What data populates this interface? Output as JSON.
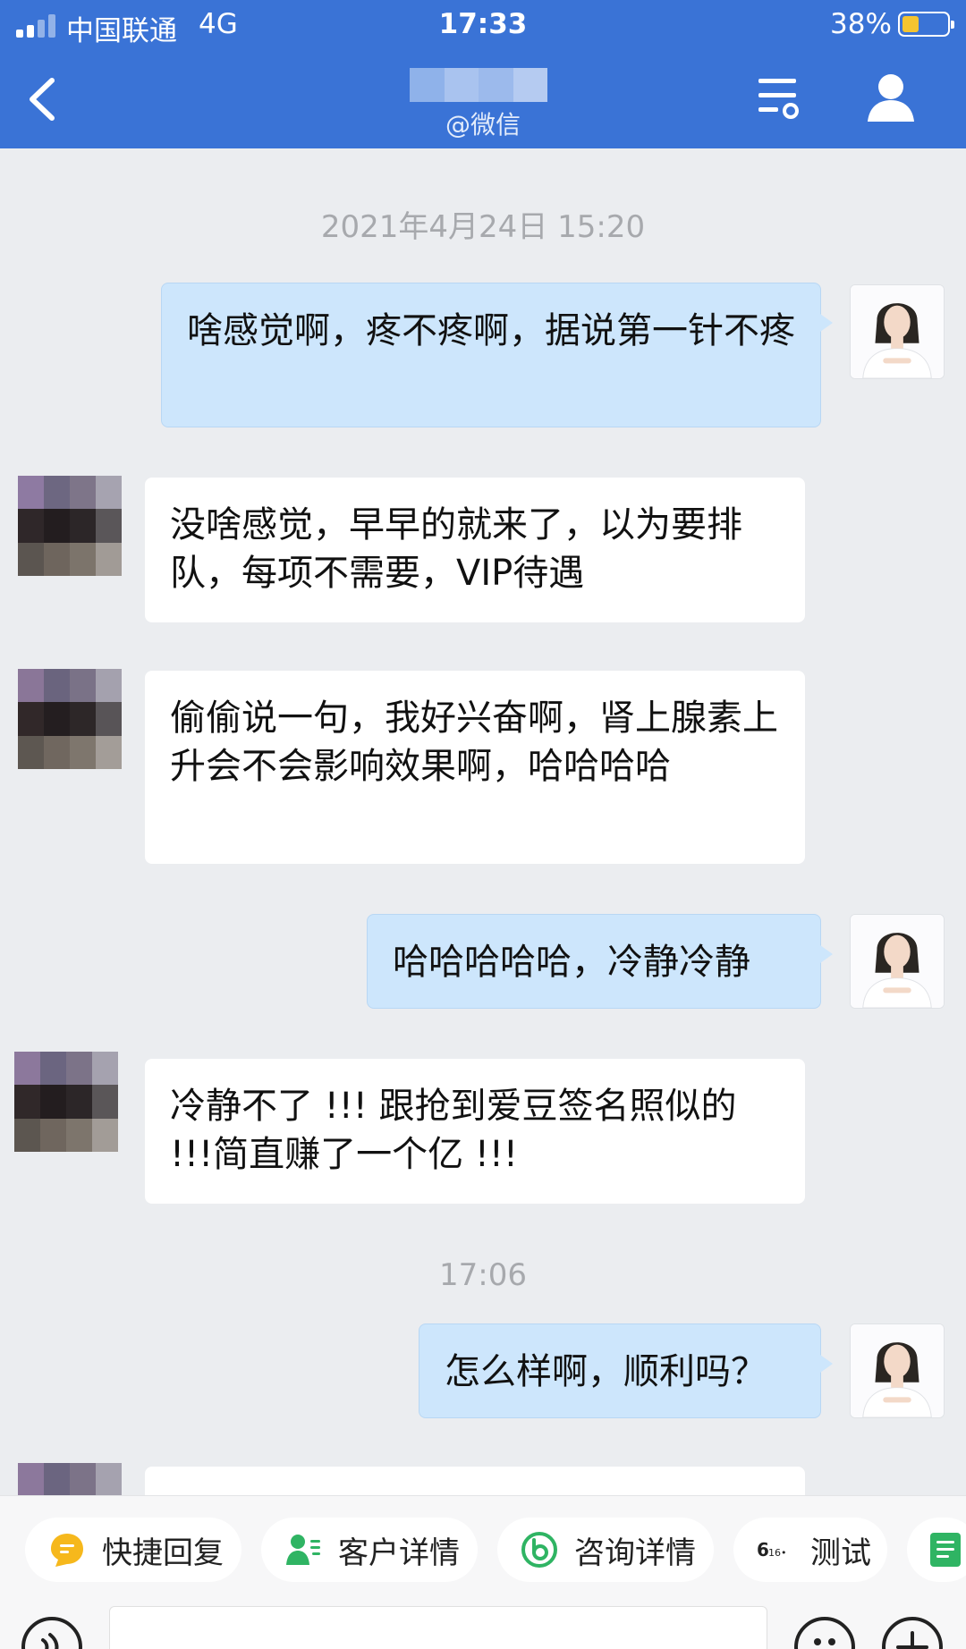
{
  "status_bar": {
    "carrier": "中国联通",
    "network": "4G",
    "time": "17:33",
    "battery_percent": "38%",
    "battery_level": 0.38
  },
  "nav": {
    "subtitle": "@微信"
  },
  "chat": {
    "timestamps": [
      "2021年4月24日 15:20",
      "17:06"
    ],
    "messages": [
      {
        "direction": "sent",
        "text": "啥感觉啊，疼不疼啊，据说第一针不疼"
      },
      {
        "direction": "received",
        "text": "没啥感觉，早早的就来了，以为要排队，每项不需要，VIP待遇"
      },
      {
        "direction": "received",
        "text": "偷偷说一句，我好兴奋啊，肾上腺素上升会不会影响效果啊，哈哈哈哈"
      },
      {
        "direction": "sent",
        "text": "哈哈哈哈哈，冷静冷静"
      },
      {
        "direction": "received",
        "text": "冷静不了 !!! 跟抢到爱豆签名照似的 !!!简直赚了一个亿 !!!"
      },
      {
        "direction": "sent",
        "text": "怎么样啊，顺利吗？"
      }
    ]
  },
  "quick_actions": [
    {
      "label": "快捷回复",
      "icon": "quick-reply-icon"
    },
    {
      "label": "客户详情",
      "icon": "customer-detail-icon"
    },
    {
      "label": "咨询详情",
      "icon": "consult-detail-icon"
    },
    {
      "label": "测试",
      "icon": "test-icon"
    },
    {
      "label": "",
      "icon": "note-icon"
    }
  ],
  "colors": {
    "header": "#3a73d6",
    "sent_bubble": "#cde6fc",
    "received_bubble": "#ffffff",
    "background": "#ebedf0",
    "quick_reply_icon": "#f6b81c",
    "green_icon": "#2fb463"
  }
}
